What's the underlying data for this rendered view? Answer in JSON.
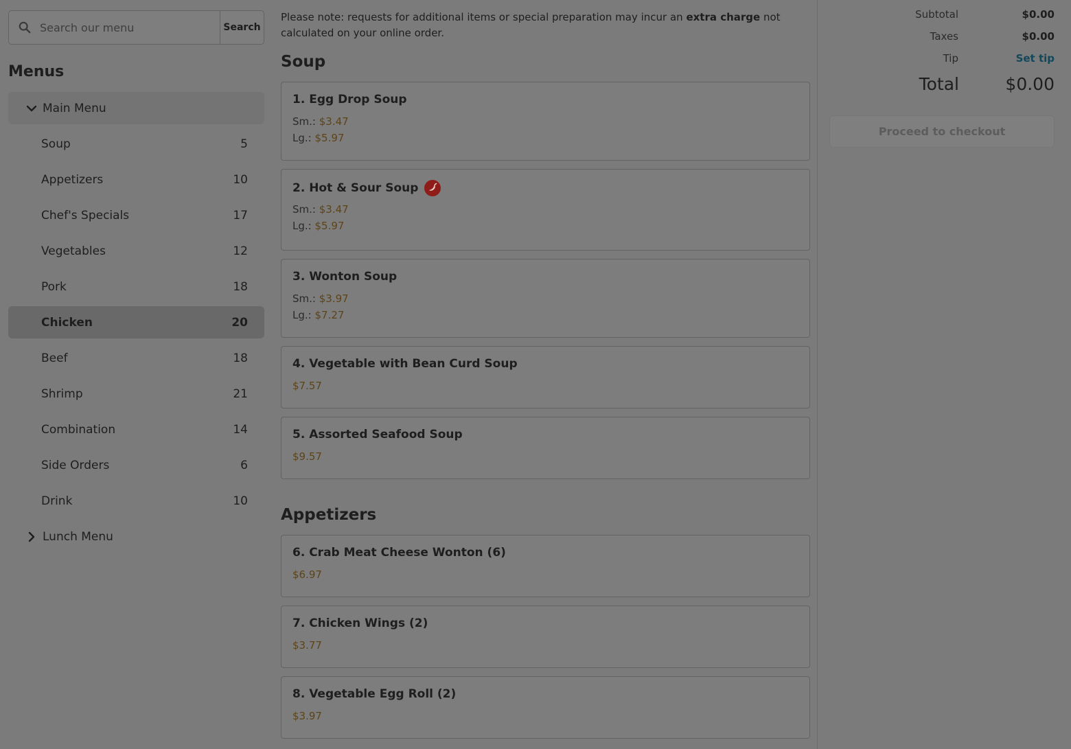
{
  "search": {
    "placeholder": "Search our menu",
    "button_label": "Search"
  },
  "sidebar": {
    "title": "Menus",
    "groups": [
      {
        "label": "Main Menu",
        "expanded": true
      },
      {
        "label": "Lunch Menu",
        "expanded": false
      }
    ],
    "categories": [
      {
        "label": "Soup",
        "count": "5"
      },
      {
        "label": "Appetizers",
        "count": "10"
      },
      {
        "label": "Chef's Specials",
        "count": "17"
      },
      {
        "label": "Vegetables",
        "count": "12"
      },
      {
        "label": "Pork",
        "count": "18"
      },
      {
        "label": "Chicken",
        "count": "20",
        "active": true
      },
      {
        "label": "Beef",
        "count": "18"
      },
      {
        "label": "Shrimp",
        "count": "21"
      },
      {
        "label": "Combination",
        "count": "14"
      },
      {
        "label": "Side Orders",
        "count": "6"
      },
      {
        "label": "Drink",
        "count": "10"
      }
    ]
  },
  "notice": {
    "before": "Please note: requests for additional items or special preparation may incur an ",
    "bold": "extra charge",
    "after": " not calculated on your online order."
  },
  "sections": [
    {
      "title": "Soup",
      "items": [
        {
          "name": "1. Egg Drop Soup",
          "spicy": false,
          "prices": [
            {
              "size": "Sm.:",
              "price": "$3.47"
            },
            {
              "size": "Lg.:",
              "price": "$5.97"
            }
          ]
        },
        {
          "name": "2. Hot & Sour Soup",
          "spicy": true,
          "prices": [
            {
              "size": "Sm.:",
              "price": "$3.47"
            },
            {
              "size": "Lg.:",
              "price": "$5.97"
            }
          ]
        },
        {
          "name": "3. Wonton Soup",
          "spicy": false,
          "prices": [
            {
              "size": "Sm.:",
              "price": "$3.97"
            },
            {
              "size": "Lg.:",
              "price": "$7.27"
            }
          ]
        },
        {
          "name": "4. Vegetable with Bean Curd Soup",
          "spicy": false,
          "prices": [
            {
              "size": "",
              "price": "$7.57"
            }
          ]
        },
        {
          "name": "5. Assorted Seafood Soup",
          "spicy": false,
          "prices": [
            {
              "size": "",
              "price": "$9.57"
            }
          ]
        }
      ]
    },
    {
      "title": "Appetizers",
      "items": [
        {
          "name": "6. Crab Meat Cheese Wonton (6)",
          "spicy": false,
          "prices": [
            {
              "size": "",
              "price": "$6.97"
            }
          ]
        },
        {
          "name": "7. Chicken Wings (2)",
          "spicy": false,
          "prices": [
            {
              "size": "",
              "price": "$3.77"
            }
          ]
        },
        {
          "name": "8. Vegetable Egg Roll (2)",
          "spicy": false,
          "prices": [
            {
              "size": "",
              "price": "$3.97"
            }
          ]
        }
      ]
    }
  ],
  "summary": {
    "subtotal_label": "Subtotal",
    "subtotal_value": "$0.00",
    "taxes_label": "Taxes",
    "taxes_value": "$0.00",
    "tip_label": "Tip",
    "tip_value": "Set tip",
    "total_label": "Total",
    "total_value": "$0.00",
    "checkout_label": "Proceed to checkout"
  },
  "icons": {
    "search": "search-icon",
    "expanded": "chevron-down-icon",
    "collapsed": "chevron-right-icon",
    "spicy": "chili-pepper-icon"
  },
  "colors": {
    "price": "#5d4417",
    "link": "#13485a",
    "spicy_badge": "#8e1d1a"
  }
}
